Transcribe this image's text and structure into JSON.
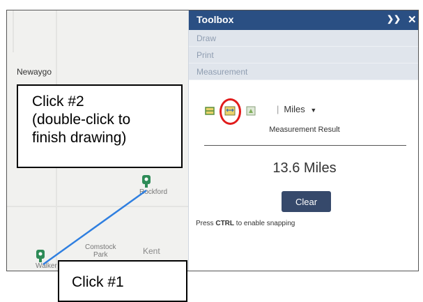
{
  "map": {
    "places": {
      "newaygo": "Newaygo",
      "rockford": "Rockford",
      "comstock_park": "Comstock\nPark",
      "kent": "Kent",
      "walker": "Walker"
    },
    "measure_line_color": "#2f7fe0",
    "marker_color": "#2e8b57"
  },
  "toolbox": {
    "title": "Toolbox",
    "collapse_icon": "double-chevron-up-icon",
    "close_icon": "close-icon",
    "items": [
      {
        "label": "Draw"
      },
      {
        "label": "Print"
      },
      {
        "label": "Measurement"
      }
    ],
    "measurement": {
      "tools": [
        "area-tool-icon",
        "distance-tool-icon",
        "location-tool-icon"
      ],
      "units": "Miles",
      "result_label": "Measurement Result",
      "result_value": "13.6 Miles",
      "clear_label": "Clear",
      "hint_prefix": "Press ",
      "hint_key": "CTRL",
      "hint_suffix": " to enable snapping"
    },
    "header_color": "#2a4f83",
    "button_color": "#36496b"
  },
  "annotations": {
    "click2": "Click #2\n(double-click to\nfinish drawing)",
    "click1": "Click #1",
    "highlight_color": "#e11b1b"
  }
}
